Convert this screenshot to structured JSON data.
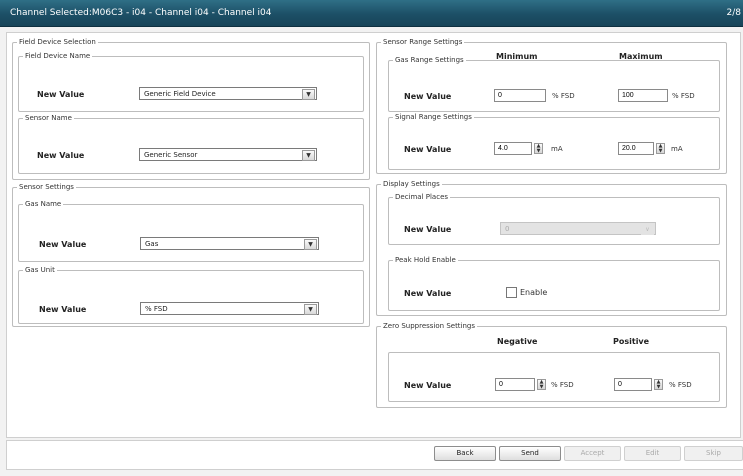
{
  "window": {
    "title": "Channel Selected:M06C3 - i04 - Channel i04 - Channel i04",
    "page": "2/8"
  },
  "field_device_selection": {
    "legend": "Field Device Selection",
    "field_device_name": {
      "legend": "Field Device Name",
      "label": "New Value",
      "value": "Generic Field Device"
    },
    "sensor_name": {
      "legend": "Sensor Name",
      "label": "New Value",
      "value": "Generic Sensor"
    }
  },
  "sensor_settings": {
    "legend": "Sensor Settings",
    "gas_name": {
      "legend": "Gas Name",
      "label": "New Value",
      "value": "Gas"
    },
    "gas_unit": {
      "legend": "Gas Unit",
      "label": "New Value",
      "value": "% FSD"
    }
  },
  "sensor_range_settings": {
    "legend": "Sensor Range Settings",
    "header_minimum": "Minimum",
    "header_maximum": "Maximum",
    "gas_range": {
      "legend": "Gas Range Settings",
      "label": "New Value",
      "min": "0",
      "min_unit": "% FSD",
      "max": "100",
      "max_unit": "% FSD"
    },
    "signal_range": {
      "legend": "Signal Range Settings",
      "label": "New Value",
      "min": "4.0",
      "min_unit": "mA",
      "max": "20.0",
      "max_unit": "mA"
    }
  },
  "display_settings": {
    "legend": "Display Settings",
    "decimal_places": {
      "legend": "Decimal Places",
      "label": "New Value",
      "value": "0"
    },
    "peak_hold": {
      "legend": "Peak Hold Enable",
      "label": "New Value",
      "checkbox_label": "Enable",
      "checked": false
    }
  },
  "zero_suppression": {
    "legend": "Zero Suppression Settings",
    "header_negative": "Negative",
    "header_positive": "Positive",
    "label": "New Value",
    "negative": "0",
    "negative_unit": "% FSD",
    "positive": "0",
    "positive_unit": "% FSD"
  },
  "buttons": {
    "back": "Back",
    "send": "Send",
    "accept": "Accept",
    "edit": "Edit",
    "skip": "Skip"
  },
  "icons": {
    "dropdown": "chevron-down-icon",
    "spin": "spin-updown-icon"
  }
}
